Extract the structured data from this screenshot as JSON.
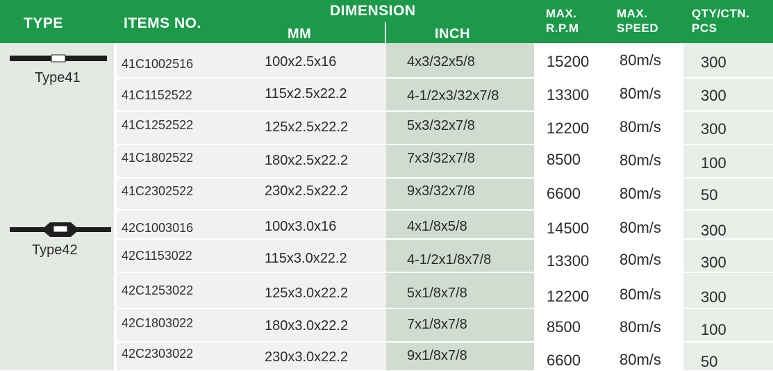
{
  "header": {
    "type": "TYPE",
    "items_no": "ITEMS NO.",
    "dimension": "DIMENSION",
    "mm": "MM",
    "inch": "INCH",
    "max_rpm_line1": "MAX.",
    "max_rpm_line2": "R.P.M",
    "max_speed_line1": "MAX.",
    "max_speed_line2": "SPEED",
    "qty_line1": "QTY/CTN.",
    "qty_line2": "PCS"
  },
  "types": [
    {
      "label": "Type41",
      "icon": "flat-disc-profile-icon"
    },
    {
      "label": "Type42",
      "icon": "depressed-center-disc-profile-icon"
    }
  ],
  "colors": {
    "header_green": "#1c9a4a",
    "type_column": "#e4e9e4",
    "inch_column": "#cfdccf",
    "qty_column": "#e8eee8"
  },
  "rows": [
    {
      "item": "41C1002516",
      "mm": "100x2.5x16",
      "inch": "4x3/32x5/8",
      "rpm": "15200",
      "speed": "80m/s",
      "qty": "300"
    },
    {
      "item": "41C1152522",
      "mm": "115x2.5x22.2",
      "inch": "4-1/2x3/32x7/8",
      "rpm": "13300",
      "speed": "80m/s",
      "qty": "300"
    },
    {
      "item": "41C1252522",
      "mm": "125x2.5x22.2",
      "inch": "5x3/32x7/8",
      "rpm": "12200",
      "speed": "80m/s",
      "qty": "300"
    },
    {
      "item": "41C1802522",
      "mm": "180x2.5x22.2",
      "inch": "7x3/32x7/8",
      "rpm": "8500",
      "speed": "80m/s",
      "qty": "100"
    },
    {
      "item": "41C2302522",
      "mm": "230x2.5x22.2",
      "inch": "9x3/32x7/8",
      "rpm": "6600",
      "speed": "80m/s",
      "qty": "50"
    },
    {
      "item": "42C1003016",
      "mm": "100x3.0x16",
      "inch": "4x1/8x5/8",
      "rpm": "14500",
      "speed": "80m/s",
      "qty": "300"
    },
    {
      "item": "42C1153022",
      "mm": "115x3.0x22.2",
      "inch": "4-1/2x1/8x7/8",
      "rpm": "13300",
      "speed": "80m/s",
      "qty": "300"
    },
    {
      "item": "42C1253022",
      "mm": "125x3.0x22.2",
      "inch": "5x1/8x7/8",
      "rpm": "12200",
      "speed": "80m/s",
      "qty": "300"
    },
    {
      "item": "42C1803022",
      "mm": "180x3.0x22.2",
      "inch": "7x1/8x7/8",
      "rpm": "8500",
      "speed": "80m/s",
      "qty": "100"
    },
    {
      "item": "42C2303022",
      "mm": "230x3.0x22.2",
      "inch": "9x1/8x7/8",
      "rpm": "6600",
      "speed": "80m/s",
      "qty": "50"
    }
  ]
}
